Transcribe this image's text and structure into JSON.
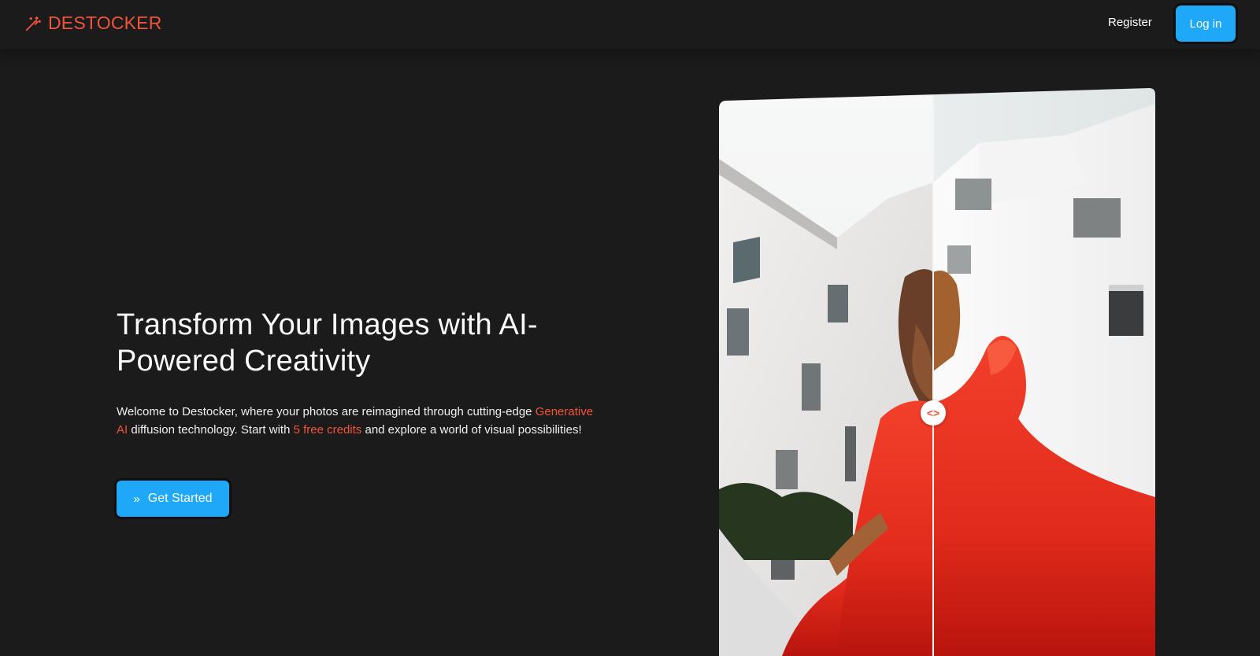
{
  "brand": {
    "name": "DESTOCKER",
    "color": "#f2533a"
  },
  "nav": {
    "register_label": "Register",
    "login_label": "Log in",
    "accent": "#1fa8f7"
  },
  "hero": {
    "title": "Transform Your Images with AI-Powered Creativity",
    "desc_part1": "Welcome to Destocker, where your photos are reimagined through cutting-edge ",
    "desc_highlight1": "Generative AI",
    "desc_part2": " diffusion technology. Start with ",
    "desc_highlight2": "5 free credits",
    "desc_part3": " and explore a world of visual possibilities!",
    "cta_label": "Get Started",
    "cta_icon": "double-chevron-right-icon"
  },
  "comparison": {
    "handle_icon": "code-arrows-icon",
    "handle_glyph": "<>"
  }
}
